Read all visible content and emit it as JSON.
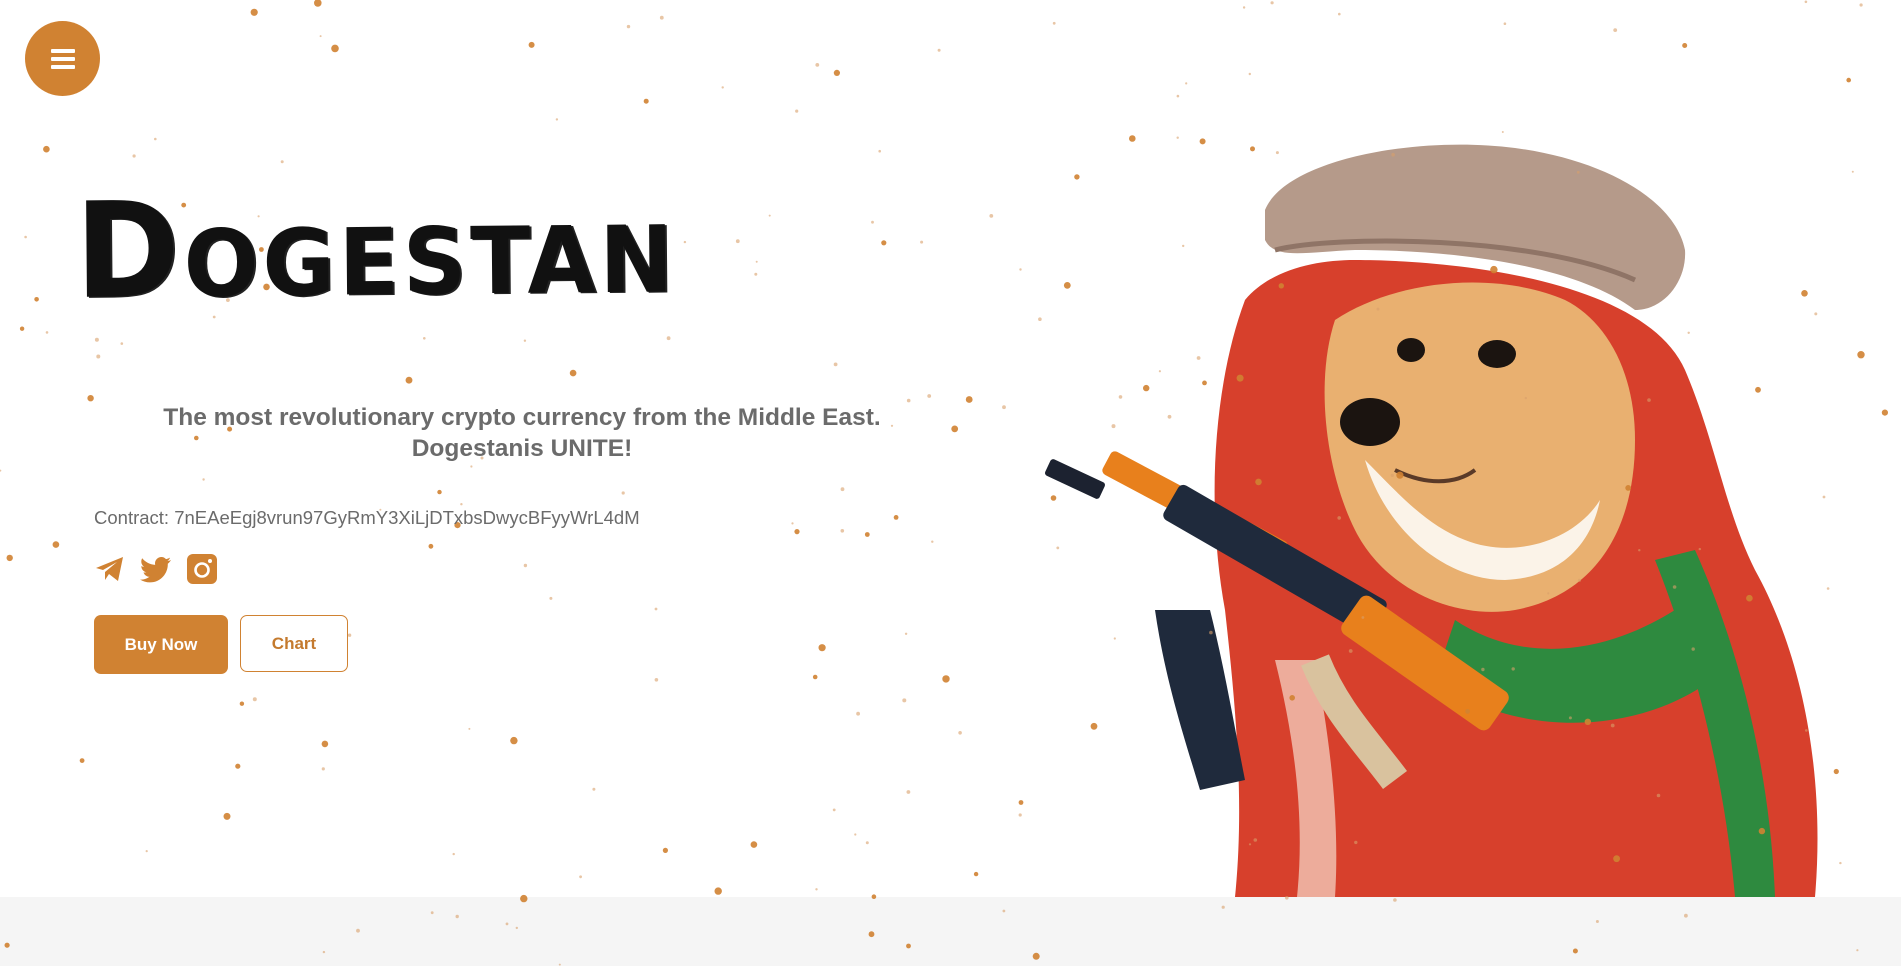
{
  "menu": {
    "icon": "hamburger-menu-icon"
  },
  "hero": {
    "title": "Dogestan",
    "tagline_line1": "The most revolutionary crypto currency from the Middle East.",
    "tagline_line2": "Dogestanis UNITE!",
    "contract_label": "Contract:",
    "contract_address": "7nEAeEgj8vrun97GyRmY3XiLjDTxbsDwycBFyyWrL4dM",
    "buy_label": "Buy Now",
    "chart_label": "Chart"
  },
  "socials": [
    {
      "icon": "telegram-icon"
    },
    {
      "icon": "twitter-icon"
    },
    {
      "icon": "instagram-icon"
    }
  ],
  "colors": {
    "accent": "#d08232",
    "text_muted": "#6b6b6b",
    "footer_band": "#f5f5f5"
  }
}
